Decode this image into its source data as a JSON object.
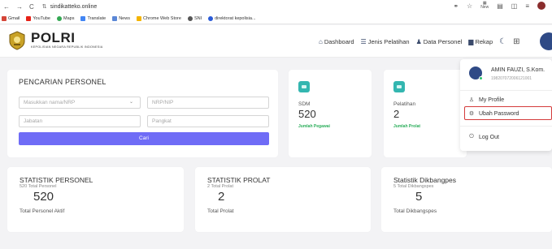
{
  "browser": {
    "url": "sindikatteko.online",
    "bookmarks": [
      "Gmail",
      "YouTube",
      "Maps",
      "Translate",
      "News",
      "Chrome Web Store",
      "SNI",
      "direktorat kepolisia..."
    ]
  },
  "header": {
    "brand_name": "POLRI",
    "brand_sub": "KEPOLISIAN NEGARA REPUBLIK INDONESIA",
    "menu": {
      "dashboard": "Dashboard",
      "jenis_pelatihan": "Jenis Pelatihan",
      "data_personel": "Data Personel",
      "rekap": "Rekap"
    }
  },
  "search": {
    "title": "PENCARIAN PERSONEL",
    "name_placeholder": "Masukkan nama/NRP",
    "nrp_placeholder": "NRP/NIP",
    "jabatan_placeholder": "Jabatan",
    "pangkat_placeholder": "Pangkat",
    "button": "Cari"
  },
  "tiles": [
    {
      "label": "SDM",
      "value": "520",
      "sub": "Jumlah Pegawai"
    },
    {
      "label": "Pelatihan",
      "value": "2",
      "sub": "Jumlah Prolat"
    }
  ],
  "stats": [
    {
      "title": "STATISTIK PERSONEL",
      "sub": "520 Total Personel",
      "value": "520",
      "footer": "Total Personel Aktif"
    },
    {
      "title": "STATISTIK PROLAT",
      "sub": "2 Total Prolat",
      "value": "2",
      "footer": "Total Prolat"
    },
    {
      "title": "Statistik Dikbangpes",
      "sub": "5 Total Dikbangspes",
      "value": "5",
      "footer": "Total Dikbangspes"
    }
  ],
  "profile_menu": {
    "name": "AMIN FAUZI, S.Kom.",
    "nip": "198207072006121001",
    "my_profile": "My Profile",
    "ubah_password": "Ubah Password",
    "log_out": "Log Out"
  },
  "colors": {
    "accent": "#6f6cf6",
    "tile_icon": "#33b6b0",
    "status_green": "#2cae5b",
    "highlight": "#d43b3b"
  },
  "icons": [
    "home-icon",
    "list-icon",
    "users-icon",
    "report-icon",
    "moon-icon",
    "grid-icon",
    "user-icon",
    "settings-icon",
    "power-icon"
  ]
}
